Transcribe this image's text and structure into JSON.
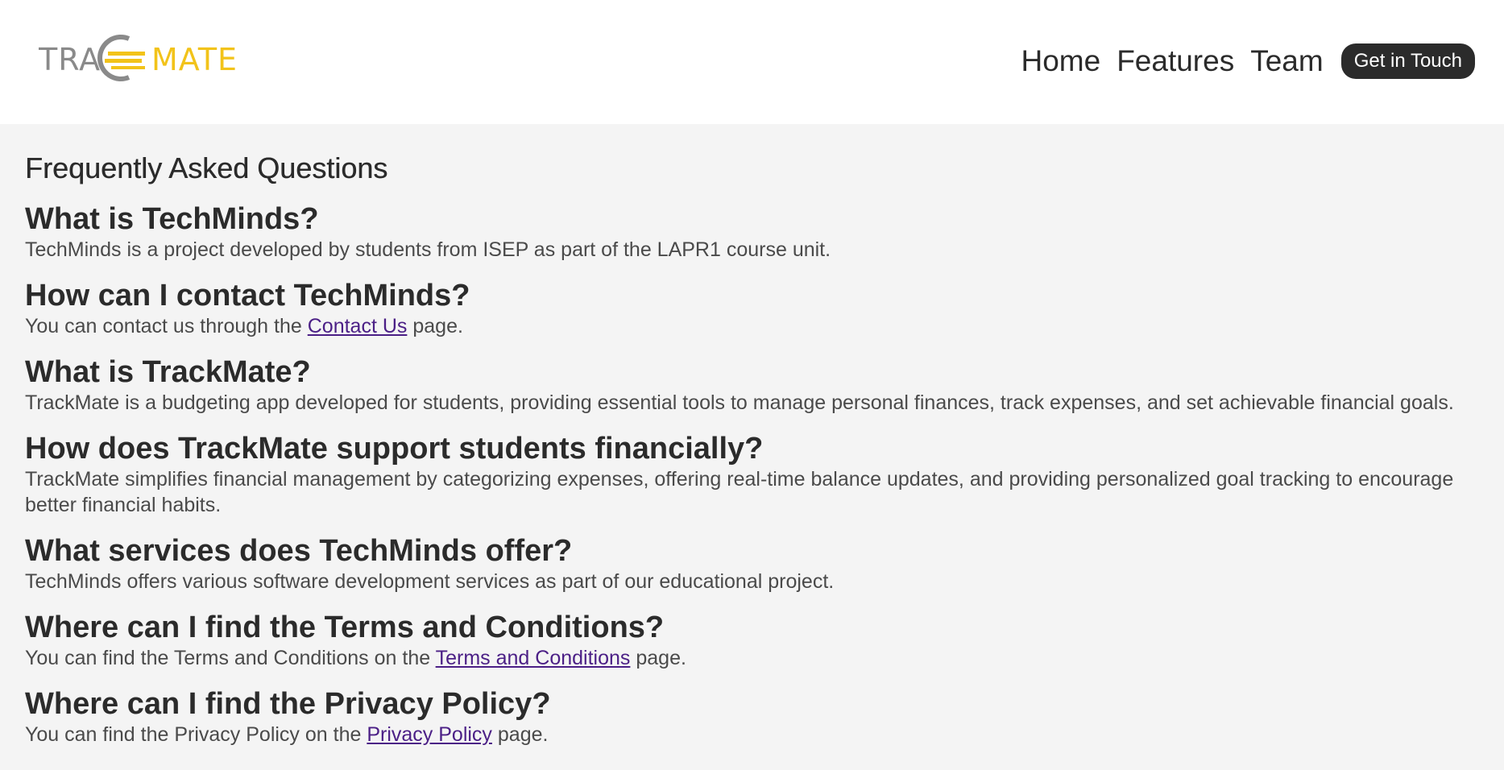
{
  "header": {
    "logo_text": "TRACKMATE",
    "brand_color": "#f2c31a",
    "logo_gray": "#8a8a8a",
    "nav": [
      {
        "label": "Home"
      },
      {
        "label": "Features"
      },
      {
        "label": "Team"
      }
    ],
    "cta_label": "Get in Touch"
  },
  "main": {
    "title": "Frequently Asked Questions",
    "faq": [
      {
        "question": "What is TechMinds?",
        "answer_before": "TechMinds is a project developed by students from ISEP as part of the LAPR1 course unit.",
        "link": "",
        "answer_after": ""
      },
      {
        "question": "How can I contact TechMinds?",
        "answer_before": "You can contact us through the ",
        "link": "Contact Us",
        "answer_after": " page."
      },
      {
        "question": "What is TrackMate?",
        "answer_before": "TrackMate is a budgeting app developed for students, providing essential tools to manage personal finances, track expenses, and set achievable financial goals.",
        "link": "",
        "answer_after": ""
      },
      {
        "question": "How does TrackMate support students financially?",
        "answer_before": "TrackMate simplifies financial management by categorizing expenses, offering real-time balance updates, and providing personalized goal tracking to encourage better financial habits.",
        "link": "",
        "answer_after": ""
      },
      {
        "question": "What services does TechMinds offer?",
        "answer_before": "TechMinds offers various software development services as part of our educational project.",
        "link": "",
        "answer_after": ""
      },
      {
        "question": "Where can I find the Terms and Conditions?",
        "answer_before": "You can find the Terms and Conditions on the ",
        "link": "Terms and Conditions",
        "answer_after": " page."
      },
      {
        "question": "Where can I find the Privacy Policy?",
        "answer_before": "You can find the Privacy Policy on the ",
        "link": "Privacy Policy",
        "answer_after": " page."
      }
    ]
  }
}
